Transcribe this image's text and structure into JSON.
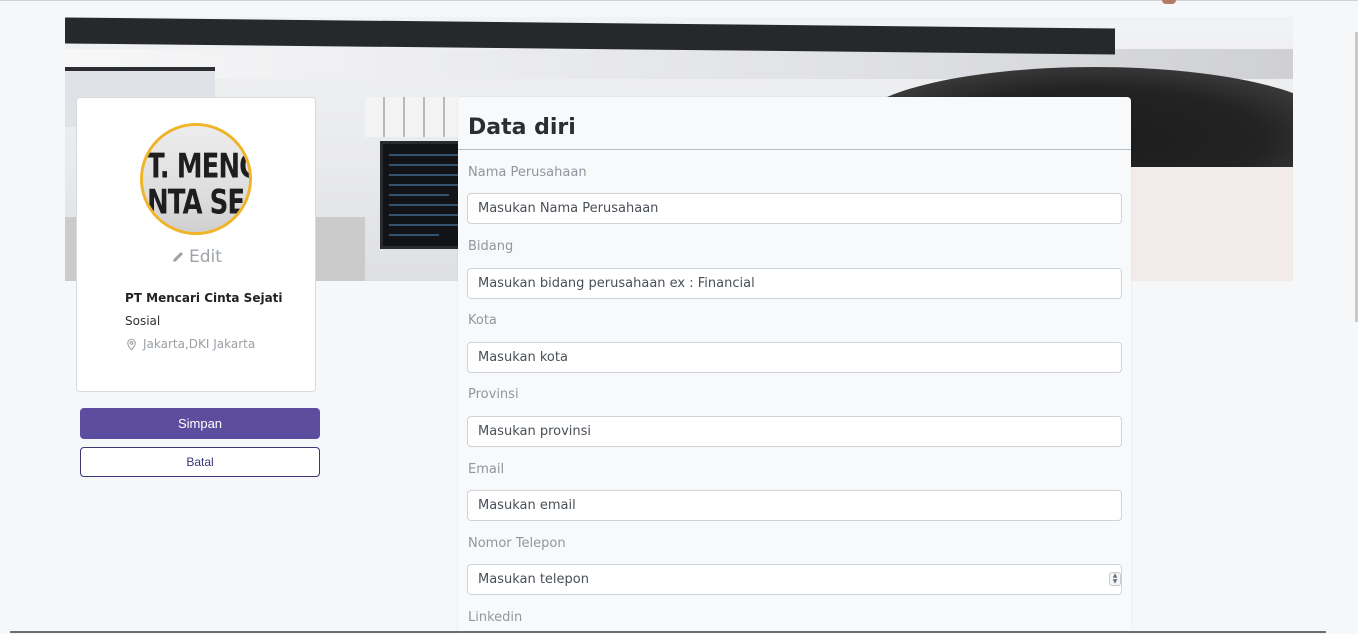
{
  "profile": {
    "edit_label": "Edit",
    "company_name": "PT Mencari Cinta Sejati",
    "sector": "Sosial",
    "location": "Jakarta,DKI Jakarta",
    "avatar_text_line1": "T. MENG",
    "avatar_text_line2": "NTA SE"
  },
  "actions": {
    "save_label": "Simpan",
    "cancel_label": "Batal"
  },
  "form": {
    "title": "Data diri",
    "fields": [
      {
        "label": "Nama Perusahaan",
        "placeholder": "Masukan Nama Perusahaan"
      },
      {
        "label": "Bidang",
        "placeholder": "Masukan bidang perusahaan ex : Financial"
      },
      {
        "label": "Kota",
        "placeholder": "Masukan kota"
      },
      {
        "label": "Provinsi",
        "placeholder": "Masukan provinsi"
      },
      {
        "label": "Email",
        "placeholder": "Masukan email"
      },
      {
        "label": "Nomor Telepon",
        "placeholder": "Masukan telepon"
      },
      {
        "label": "Linkedin",
        "placeholder": ""
      }
    ]
  },
  "colors": {
    "primary": "#5c4d9e",
    "outline": "#3b3875",
    "avatar_ring": "#f0b429"
  }
}
